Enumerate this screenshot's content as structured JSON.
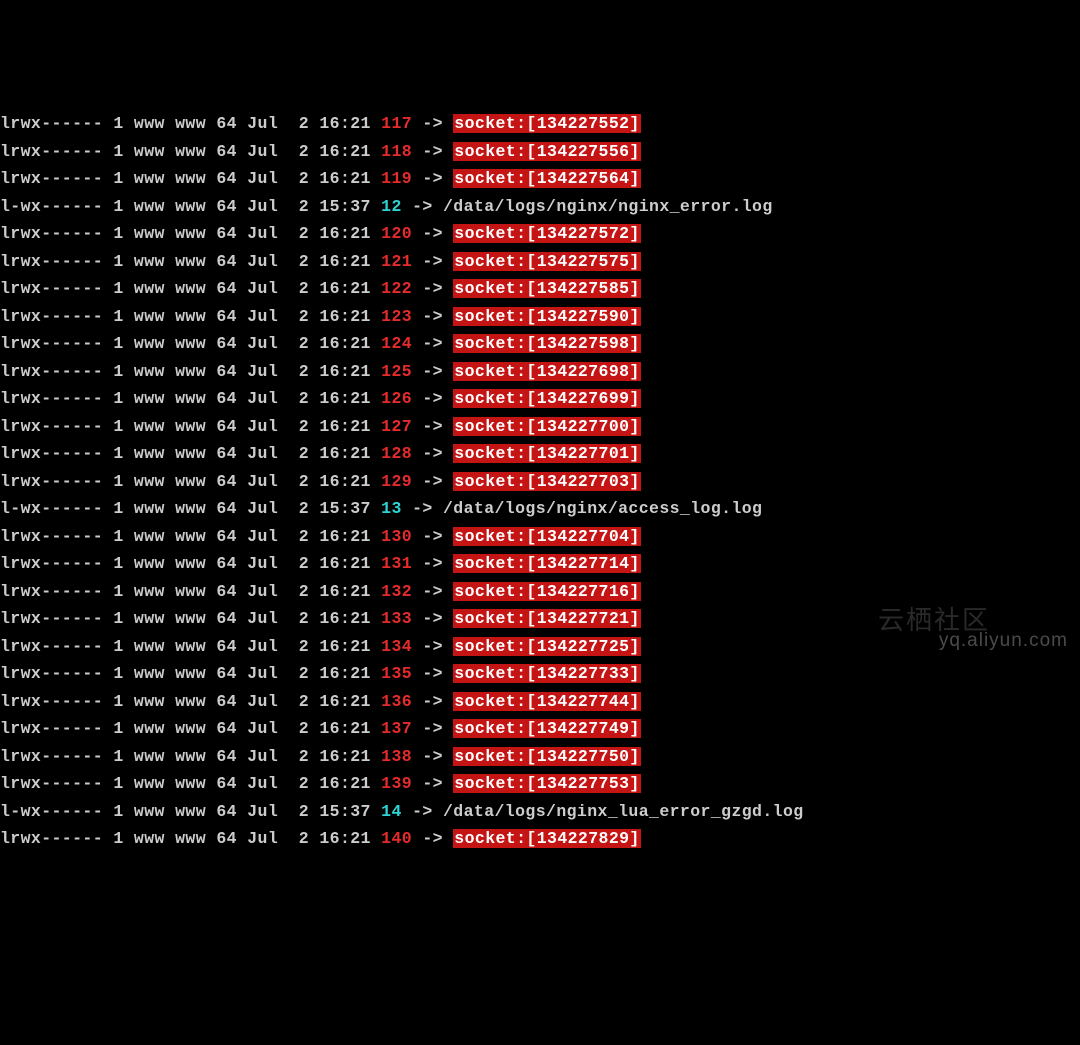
{
  "watermark": "yq.aliyun.com",
  "watermark_cn": "云栖社区",
  "rows": [
    {
      "perms": "lrwx------",
      "links": "1",
      "user": "www",
      "grp": "www",
      "size": "64",
      "mon": "Jul",
      "day": " 2",
      "time": "16:21",
      "fd": "117",
      "target": "socket:[134227552]",
      "type": "socket"
    },
    {
      "perms": "lrwx------",
      "links": "1",
      "user": "www",
      "grp": "www",
      "size": "64",
      "mon": "Jul",
      "day": " 2",
      "time": "16:21",
      "fd": "118",
      "target": "socket:[134227556]",
      "type": "socket"
    },
    {
      "perms": "lrwx------",
      "links": "1",
      "user": "www",
      "grp": "www",
      "size": "64",
      "mon": "Jul",
      "day": " 2",
      "time": "16:21",
      "fd": "119",
      "target": "socket:[134227564]",
      "type": "socket"
    },
    {
      "perms": "l-wx------",
      "links": "1",
      "user": "www",
      "grp": "www",
      "size": "64",
      "mon": "Jul",
      "day": " 2",
      "time": "15:37",
      "fd": "12",
      "target": "/data/logs/nginx/nginx_error.log",
      "type": "file"
    },
    {
      "perms": "lrwx------",
      "links": "1",
      "user": "www",
      "grp": "www",
      "size": "64",
      "mon": "Jul",
      "day": " 2",
      "time": "16:21",
      "fd": "120",
      "target": "socket:[134227572]",
      "type": "socket"
    },
    {
      "perms": "lrwx------",
      "links": "1",
      "user": "www",
      "grp": "www",
      "size": "64",
      "mon": "Jul",
      "day": " 2",
      "time": "16:21",
      "fd": "121",
      "target": "socket:[134227575]",
      "type": "socket"
    },
    {
      "perms": "lrwx------",
      "links": "1",
      "user": "www",
      "grp": "www",
      "size": "64",
      "mon": "Jul",
      "day": " 2",
      "time": "16:21",
      "fd": "122",
      "target": "socket:[134227585]",
      "type": "socket"
    },
    {
      "perms": "lrwx------",
      "links": "1",
      "user": "www",
      "grp": "www",
      "size": "64",
      "mon": "Jul",
      "day": " 2",
      "time": "16:21",
      "fd": "123",
      "target": "socket:[134227590]",
      "type": "socket"
    },
    {
      "perms": "lrwx------",
      "links": "1",
      "user": "www",
      "grp": "www",
      "size": "64",
      "mon": "Jul",
      "day": " 2",
      "time": "16:21",
      "fd": "124",
      "target": "socket:[134227598]",
      "type": "socket"
    },
    {
      "perms": "lrwx------",
      "links": "1",
      "user": "www",
      "grp": "www",
      "size": "64",
      "mon": "Jul",
      "day": " 2",
      "time": "16:21",
      "fd": "125",
      "target": "socket:[134227698]",
      "type": "socket"
    },
    {
      "perms": "lrwx------",
      "links": "1",
      "user": "www",
      "grp": "www",
      "size": "64",
      "mon": "Jul",
      "day": " 2",
      "time": "16:21",
      "fd": "126",
      "target": "socket:[134227699]",
      "type": "socket"
    },
    {
      "perms": "lrwx------",
      "links": "1",
      "user": "www",
      "grp": "www",
      "size": "64",
      "mon": "Jul",
      "day": " 2",
      "time": "16:21",
      "fd": "127",
      "target": "socket:[134227700]",
      "type": "socket"
    },
    {
      "perms": "lrwx------",
      "links": "1",
      "user": "www",
      "grp": "www",
      "size": "64",
      "mon": "Jul",
      "day": " 2",
      "time": "16:21",
      "fd": "128",
      "target": "socket:[134227701]",
      "type": "socket"
    },
    {
      "perms": "lrwx------",
      "links": "1",
      "user": "www",
      "grp": "www",
      "size": "64",
      "mon": "Jul",
      "day": " 2",
      "time": "16:21",
      "fd": "129",
      "target": "socket:[134227703]",
      "type": "socket"
    },
    {
      "perms": "l-wx------",
      "links": "1",
      "user": "www",
      "grp": "www",
      "size": "64",
      "mon": "Jul",
      "day": " 2",
      "time": "15:37",
      "fd": "13",
      "target": "/data/logs/nginx/access_log.log",
      "type": "file"
    },
    {
      "perms": "lrwx------",
      "links": "1",
      "user": "www",
      "grp": "www",
      "size": "64",
      "mon": "Jul",
      "day": " 2",
      "time": "16:21",
      "fd": "130",
      "target": "socket:[134227704]",
      "type": "socket"
    },
    {
      "perms": "lrwx------",
      "links": "1",
      "user": "www",
      "grp": "www",
      "size": "64",
      "mon": "Jul",
      "day": " 2",
      "time": "16:21",
      "fd": "131",
      "target": "socket:[134227714]",
      "type": "socket"
    },
    {
      "perms": "lrwx------",
      "links": "1",
      "user": "www",
      "grp": "www",
      "size": "64",
      "mon": "Jul",
      "day": " 2",
      "time": "16:21",
      "fd": "132",
      "target": "socket:[134227716]",
      "type": "socket"
    },
    {
      "perms": "lrwx------",
      "links": "1",
      "user": "www",
      "grp": "www",
      "size": "64",
      "mon": "Jul",
      "day": " 2",
      "time": "16:21",
      "fd": "133",
      "target": "socket:[134227721]",
      "type": "socket"
    },
    {
      "perms": "lrwx------",
      "links": "1",
      "user": "www",
      "grp": "www",
      "size": "64",
      "mon": "Jul",
      "day": " 2",
      "time": "16:21",
      "fd": "134",
      "target": "socket:[134227725]",
      "type": "socket"
    },
    {
      "perms": "lrwx------",
      "links": "1",
      "user": "www",
      "grp": "www",
      "size": "64",
      "mon": "Jul",
      "day": " 2",
      "time": "16:21",
      "fd": "135",
      "target": "socket:[134227733]",
      "type": "socket"
    },
    {
      "perms": "lrwx------",
      "links": "1",
      "user": "www",
      "grp": "www",
      "size": "64",
      "mon": "Jul",
      "day": " 2",
      "time": "16:21",
      "fd": "136",
      "target": "socket:[134227744]",
      "type": "socket"
    },
    {
      "perms": "lrwx------",
      "links": "1",
      "user": "www",
      "grp": "www",
      "size": "64",
      "mon": "Jul",
      "day": " 2",
      "time": "16:21",
      "fd": "137",
      "target": "socket:[134227749]",
      "type": "socket"
    },
    {
      "perms": "lrwx------",
      "links": "1",
      "user": "www",
      "grp": "www",
      "size": "64",
      "mon": "Jul",
      "day": " 2",
      "time": "16:21",
      "fd": "138",
      "target": "socket:[134227750]",
      "type": "socket"
    },
    {
      "perms": "lrwx------",
      "links": "1",
      "user": "www",
      "grp": "www",
      "size": "64",
      "mon": "Jul",
      "day": " 2",
      "time": "16:21",
      "fd": "139",
      "target": "socket:[134227753]",
      "type": "socket"
    },
    {
      "perms": "l-wx------",
      "links": "1",
      "user": "www",
      "grp": "www",
      "size": "64",
      "mon": "Jul",
      "day": " 2",
      "time": "15:37",
      "fd": "14",
      "target": "/data/logs/nginx_lua_error_gzgd.log",
      "type": "file"
    },
    {
      "perms": "lrwx------",
      "links": "1",
      "user": "www",
      "grp": "www",
      "size": "64",
      "mon": "Jul",
      "day": " 2",
      "time": "16:21",
      "fd": "140",
      "target": "socket:[134227829]",
      "type": "socket"
    }
  ]
}
